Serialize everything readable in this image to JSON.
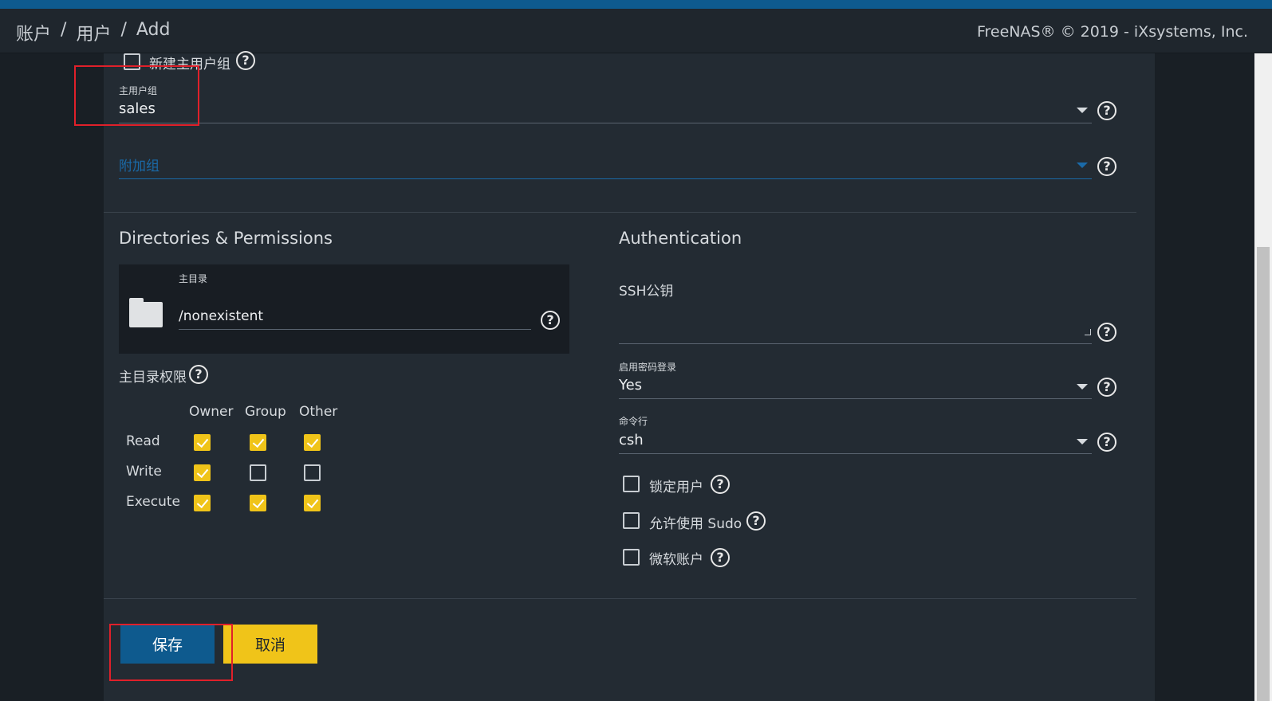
{
  "breadcrumb": {
    "items": [
      "账户",
      "用户",
      "Add"
    ],
    "sep": "/"
  },
  "copyright": "FreeNAS® © 2019 - iXsystems, Inc.",
  "groups": {
    "new_primary_group_label": "新建主用户组",
    "new_primary_group_checked": false,
    "primary_group_label": "主用户组",
    "primary_group_value": "sales",
    "aux_groups_placeholder": "附加组"
  },
  "directories": {
    "title": "Directories & Permissions",
    "home_dir_label": "主目录",
    "home_dir_value": "/nonexistent",
    "home_perm_label": "主目录权限",
    "columns": [
      "Owner",
      "Group",
      "Other"
    ],
    "rows": [
      {
        "label": "Read",
        "values": [
          true,
          true,
          true
        ]
      },
      {
        "label": "Write",
        "values": [
          true,
          false,
          false
        ]
      },
      {
        "label": "Execute",
        "values": [
          true,
          true,
          true
        ]
      }
    ]
  },
  "auth": {
    "title": "Authentication",
    "ssh_label": "SSH公钥",
    "ssh_value": "",
    "password_login_label": "启用密码登录",
    "password_login_value": "Yes",
    "shell_label": "命令行",
    "shell_value": "csh",
    "lock_user_label": "锁定用户",
    "sudo_label": "允许使用 Sudo",
    "ms_account_label": "微软账户"
  },
  "actions": {
    "save_label": "保存",
    "cancel_label": "取消"
  },
  "colors": {
    "accent_blue": "#0e5a8e",
    "accent_yellow": "#f0c419",
    "highlight_red": "#e0202a"
  }
}
